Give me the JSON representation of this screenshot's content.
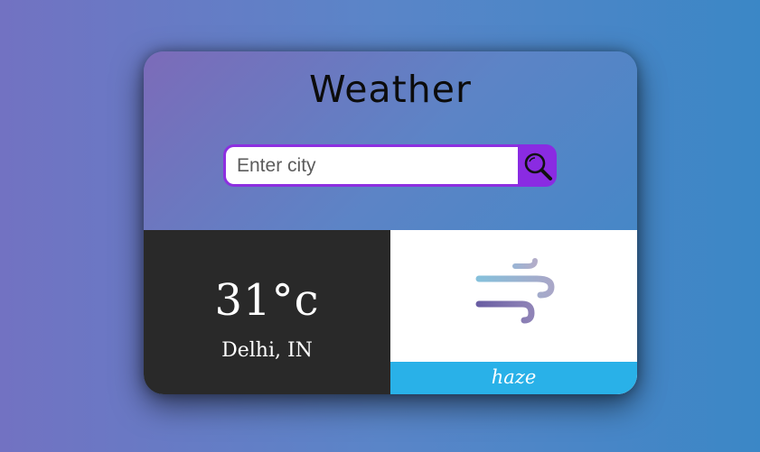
{
  "app": {
    "title": "Weather"
  },
  "search": {
    "placeholder": "Enter city",
    "value": ""
  },
  "icons": {
    "search_button": "magnifier-icon",
    "condition_icon": "wind-haze-icon"
  },
  "weather": {
    "temperature": "31°c",
    "location": "Delhi, IN",
    "condition": "haze"
  },
  "colors": {
    "accent": "#8a2be2",
    "condition_bar": "#29b1e8",
    "temp_panel": "#292929"
  }
}
